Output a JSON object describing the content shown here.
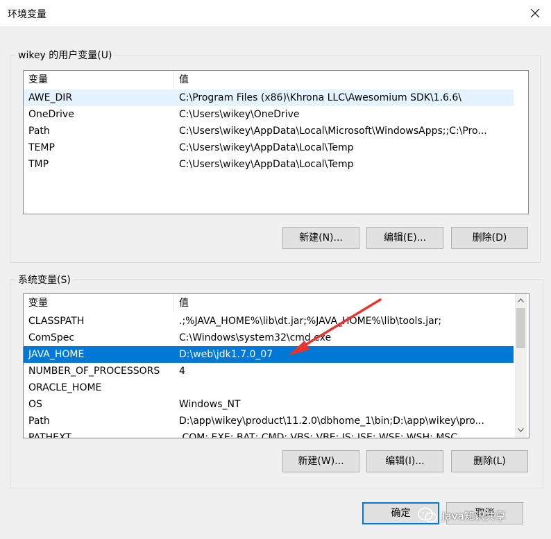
{
  "window": {
    "title": "环境变量"
  },
  "user_vars": {
    "group_label": "wikey 的用户变量(U)",
    "col_name": "变量",
    "col_value": "值",
    "rows": [
      {
        "name": "AWE_DIR",
        "value": "C:\\Program Files (x86)\\Khrona LLC\\Awesomium SDK\\1.6.6\\"
      },
      {
        "name": "OneDrive",
        "value": "C:\\Users\\wikey\\OneDrive"
      },
      {
        "name": "Path",
        "value": "C:\\Users\\wikey\\AppData\\Local\\Microsoft\\WindowsApps;;C:\\Pro..."
      },
      {
        "name": "TEMP",
        "value": "C:\\Users\\wikey\\AppData\\Local\\Temp"
      },
      {
        "name": "TMP",
        "value": "C:\\Users\\wikey\\AppData\\Local\\Temp"
      }
    ],
    "new_label": "新建(N)...",
    "edit_label": "编辑(E)...",
    "delete_label": "删除(D)"
  },
  "system_vars": {
    "group_label": "系统变量(S)",
    "col_name": "变量",
    "col_value": "值",
    "rows": [
      {
        "name": "CLASSPATH",
        "value": ".;%JAVA_HOME%\\lib\\dt.jar;%JAVA_HOME%\\lib\\tools.jar;"
      },
      {
        "name": "ComSpec",
        "value": "C:\\Windows\\system32\\cmd.exe"
      },
      {
        "name": "JAVA_HOME",
        "value": "D:\\web\\jdk1.7.0_07"
      },
      {
        "name": "NUMBER_OF_PROCESSORS",
        "value": "4"
      },
      {
        "name": "ORACLE_HOME",
        "value": ""
      },
      {
        "name": "OS",
        "value": "Windows_NT"
      },
      {
        "name": "Path",
        "value": "D:\\app\\wikey\\product\\11.2.0\\dbhome_1\\bin;D:\\app\\wikey\\pro..."
      },
      {
        "name": "PATHEXT",
        "value": ".COM;.EXE;.BAT;.CMD;.VBS;.VBE;.JS;.JSE;.WSF;.WSH;.MSC"
      }
    ],
    "selected_index": 2,
    "new_label": "新建(W)...",
    "edit_label": "编辑(I)...",
    "delete_label": "删除(L)"
  },
  "footer": {
    "ok_label": "确定",
    "cancel_label": "取消"
  },
  "watermark": {
    "text": "Java知识共享"
  },
  "colors": {
    "selection": "#0078d7",
    "annotation_arrow": "#e8342e"
  }
}
